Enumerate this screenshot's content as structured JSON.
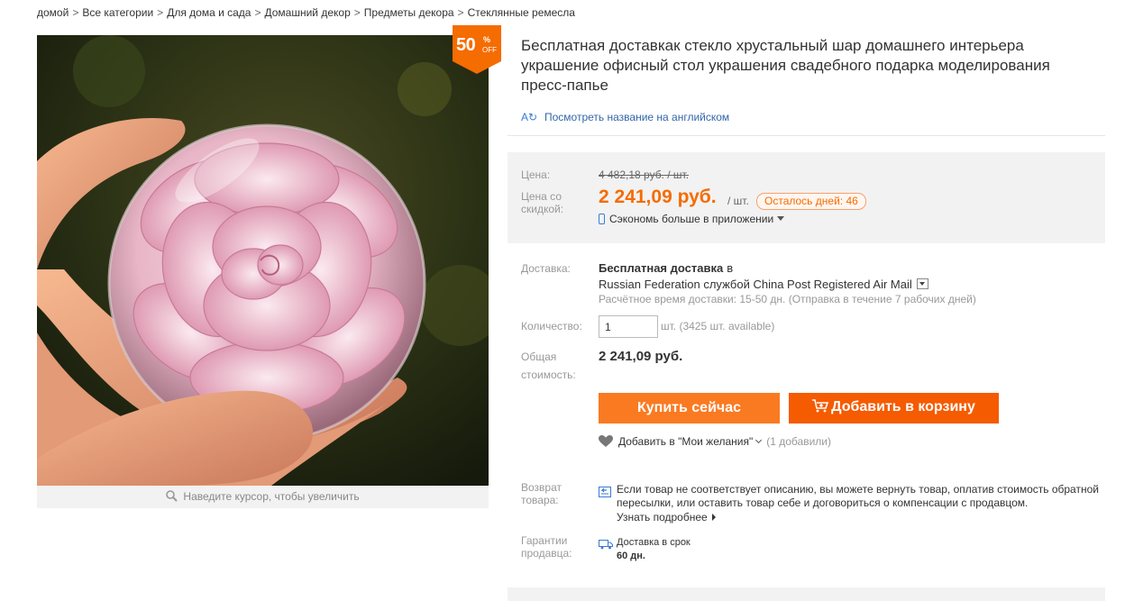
{
  "breadcrumb": [
    "домой",
    "Все категории",
    "Для дома и сада",
    "Домашний декор",
    "Предметы декора",
    "Стеклянные ремесла"
  ],
  "badge": {
    "percent": "50",
    "sign": "%",
    "off": "OFF",
    "color": "#f56c00"
  },
  "image": {
    "zoom_hint": "Наведите курсор, чтобы увеличить",
    "subject": "rose-in-glass-ball-photo"
  },
  "product": {
    "title": "Бесплатная доставкак стекло хрустальный шар домашнего интерьера украшение офисный стол украшения свадебного подарка моделирования пресс-папье",
    "translate_link": "Посмотреть название на английском"
  },
  "price": {
    "label": "Цена:",
    "old": "4 482,18 руб. / шт.",
    "discount_label": "Цена со скидкой:",
    "new": "2 241,09 руб.",
    "unit": "/ шт.",
    "days_left": "Осталось дней: 46",
    "app_save": "Сэкономь больше в приложении",
    "accent_color": "#f56c00"
  },
  "shipping": {
    "label": "Доставка:",
    "free": "Бесплатная доставка",
    "in": "в",
    "method": "Russian Federation службой China Post Registered Air Mail",
    "time": "Расчётное время доставки: 15-50 дн. (Отправка в течение 7 рабочих дней)"
  },
  "quantity": {
    "label": "Количество:",
    "value": "1",
    "note": "шт. (3425 шт. available)"
  },
  "total": {
    "label": "Общая стоимость:",
    "value": "2 241,09 руб."
  },
  "actions": {
    "buy": "Купить сейчас",
    "cart": "Добавить в корзину",
    "wishlist": "Добавить в \"Мои желания\"",
    "wish_count": "(1 добавили)"
  },
  "returns": {
    "label": "Возврат товара:",
    "text": "Если товар не соответствует описанию, вы можете вернуть товар, оплатив стоимость обратной пересылки, или оставить товар себе и договориться о компенсации с продавцом.",
    "more": "Узнать подробнее"
  },
  "guarantee": {
    "label": "Гарантии продавца:",
    "title": "Доставка в срок",
    "days": "60 дн."
  }
}
